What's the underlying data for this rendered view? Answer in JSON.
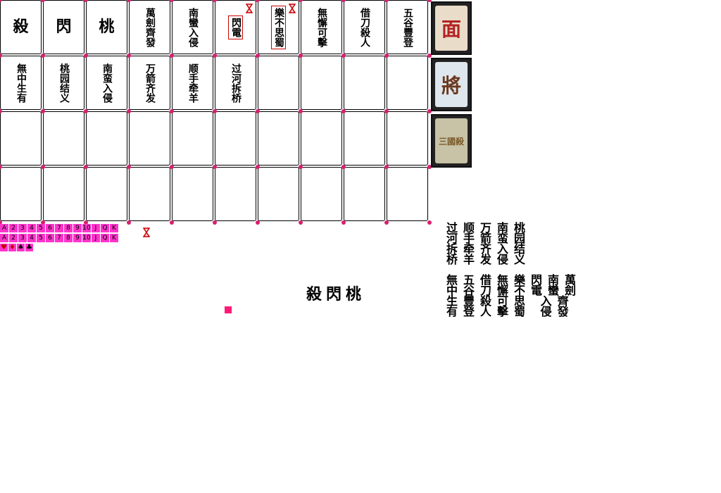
{
  "grid": {
    "rows": [
      [
        {
          "text": "殺",
          "style": "big"
        },
        {
          "text": "閃",
          "style": "big"
        },
        {
          "text": "桃",
          "style": "big"
        },
        {
          "text": "萬劍齊發"
        },
        {
          "text": "南蠻入侵"
        },
        {
          "text": "閃電",
          "style": "boxed",
          "hourglass": true
        },
        {
          "text": "樂不思蜀",
          "style": "boxed",
          "hourglass": true
        },
        {
          "text": "無懈可擊"
        },
        {
          "text": "借刀殺人"
        },
        {
          "text": "五谷豐登"
        }
      ],
      [
        {
          "text": "無中生有"
        },
        {
          "text": "桃园结义"
        },
        {
          "text": "南蛮入侵"
        },
        {
          "text": "万箭齐发"
        },
        {
          "text": "顺手牵羊"
        },
        {
          "text": "过河拆桥"
        },
        {
          "text": ""
        },
        {
          "text": ""
        },
        {
          "text": ""
        },
        {
          "text": ""
        }
      ],
      [
        {
          "text": ""
        },
        {
          "text": ""
        },
        {
          "text": ""
        },
        {
          "text": ""
        },
        {
          "text": ""
        },
        {
          "text": ""
        },
        {
          "text": ""
        },
        {
          "text": ""
        },
        {
          "text": ""
        },
        {
          "text": ""
        }
      ],
      [
        {
          "text": ""
        },
        {
          "text": ""
        },
        {
          "text": ""
        },
        {
          "text": ""
        },
        {
          "text": ""
        },
        {
          "text": ""
        },
        {
          "text": ""
        },
        {
          "text": ""
        },
        {
          "text": ""
        },
        {
          "text": ""
        }
      ]
    ]
  },
  "side_cards": [
    {
      "name": "face-mask-card",
      "glyph": "面",
      "color": "#b22222",
      "bg": "#e9dcc9"
    },
    {
      "name": "general-card",
      "glyph": "將",
      "color": "#6b3a1f",
      "bg": "#dfe7ee"
    },
    {
      "name": "card-back",
      "glyph": "三國殺",
      "color": "#7a5a2a",
      "bg": "#c8c2a6"
    }
  ],
  "sprites": {
    "ranks_row1": [
      "A",
      "2",
      "3",
      "4",
      "5",
      "6",
      "7",
      "8",
      "9",
      "10",
      "J",
      "Q",
      "K"
    ],
    "ranks_row2": [
      "A",
      "2",
      "3",
      "4",
      "5",
      "6",
      "7",
      "8",
      "9",
      "10",
      "J",
      "Q",
      "K"
    ],
    "suits": [
      "♥",
      "♦",
      "♠",
      "♣"
    ]
  },
  "center_title": "殺閃桃",
  "glyph_lines_1": [
    "过顺万南桃",
    "河手箭蛮园",
    "拆牵齐入结",
    "桥羊发侵义"
  ],
  "glyph_lines_2": [
    "無五借無樂閃南萬",
    "中谷刀懈不電蠻劍",
    "生豐殺可思 入齊",
    "有登人擊蜀 侵發"
  ],
  "colors": {
    "accent": "#d8206f",
    "sprite_bg": "#ff33cc",
    "marker": "#ff1a75"
  }
}
